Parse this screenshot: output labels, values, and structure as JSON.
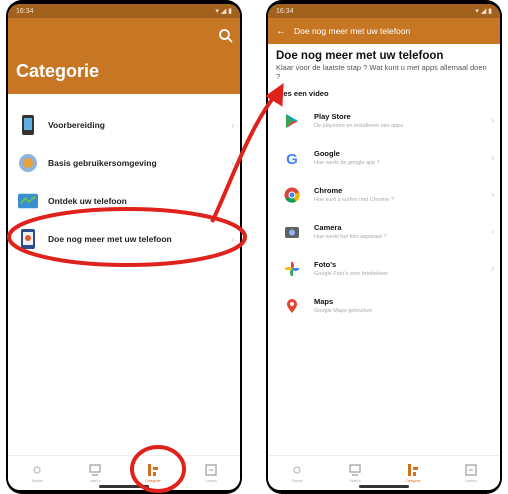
{
  "left_screen": {
    "status_time": "16:34",
    "title": "Categorie",
    "categories": [
      {
        "label": "Voorbereiding"
      },
      {
        "label": "Basis gebruikersomgeving"
      },
      {
        "label": "Ontdek uw telefoon"
      },
      {
        "label": "Doe nog meer met uw telefoon"
      }
    ],
    "nav": [
      {
        "label": "Toestel"
      },
      {
        "label": "Video's"
      },
      {
        "label": "Categorie"
      },
      {
        "label": "Lessen"
      }
    ]
  },
  "right_screen": {
    "status_time": "16:34",
    "toolbar_title": "Doe nog meer met uw telefoon",
    "heading": "Doe nog meer met uw telefoon",
    "subtitle": "Klaar voor de laatste stap ? Wat kunt u met apps allemaal doen ?",
    "section_label": "Kies een video",
    "videos": [
      {
        "title": "Play Store",
        "desc": "De playstore en installeren van apps"
      },
      {
        "title": "Google",
        "desc": "Hoe werkt de google app ?"
      },
      {
        "title": "Chrome",
        "desc": "Hoe kunt u surfen met Chrome ?"
      },
      {
        "title": "Camera",
        "desc": "Hoe werkt het foto apparaat ?"
      },
      {
        "title": "Foto's",
        "desc": "Google Foto's voor fotobeheer"
      },
      {
        "title": "Maps",
        "desc": "Google Maps gebruiken"
      }
    ],
    "nav": [
      {
        "label": "Toestel"
      },
      {
        "label": "Video's"
      },
      {
        "label": "Categorie"
      },
      {
        "label": "Lessen"
      }
    ]
  },
  "colors": {
    "accent": "#c77724",
    "statusbar": "#a2611c",
    "annotation": "#e0221c"
  }
}
